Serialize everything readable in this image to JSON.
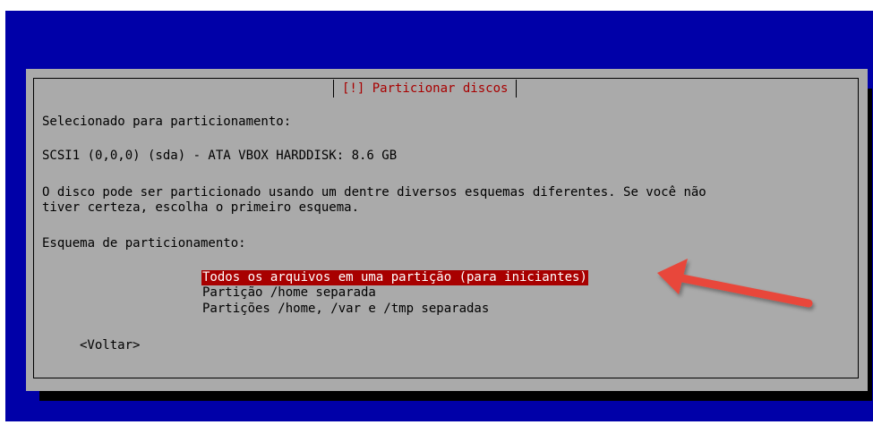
{
  "dialog": {
    "title": "[!] Particionar discos",
    "selected_label": "Selecionado para particionamento:",
    "disk": "SCSI1 (0,0,0) (sda) - ATA VBOX HARDDISK: 8.6 GB",
    "description": "O disco pode ser particionado usando um dentre diversos esquemas diferentes. Se você não\ntiver certeza, escolha o primeiro esquema.",
    "scheme_label": "Esquema de particionamento:",
    "options": [
      "Todos os arquivos em uma partição (para iniciantes)",
      "Partição /home separada",
      "Partições /home, /var e /tmp separadas"
    ],
    "selected_option": 0,
    "back_label": "<Voltar>"
  },
  "colors": {
    "screen_background": "#0000a8",
    "dialog_background": "#aaaaaa",
    "title_color": "#a80000",
    "highlight_background": "#a80000",
    "annotation_arrow": "#e8473b"
  }
}
